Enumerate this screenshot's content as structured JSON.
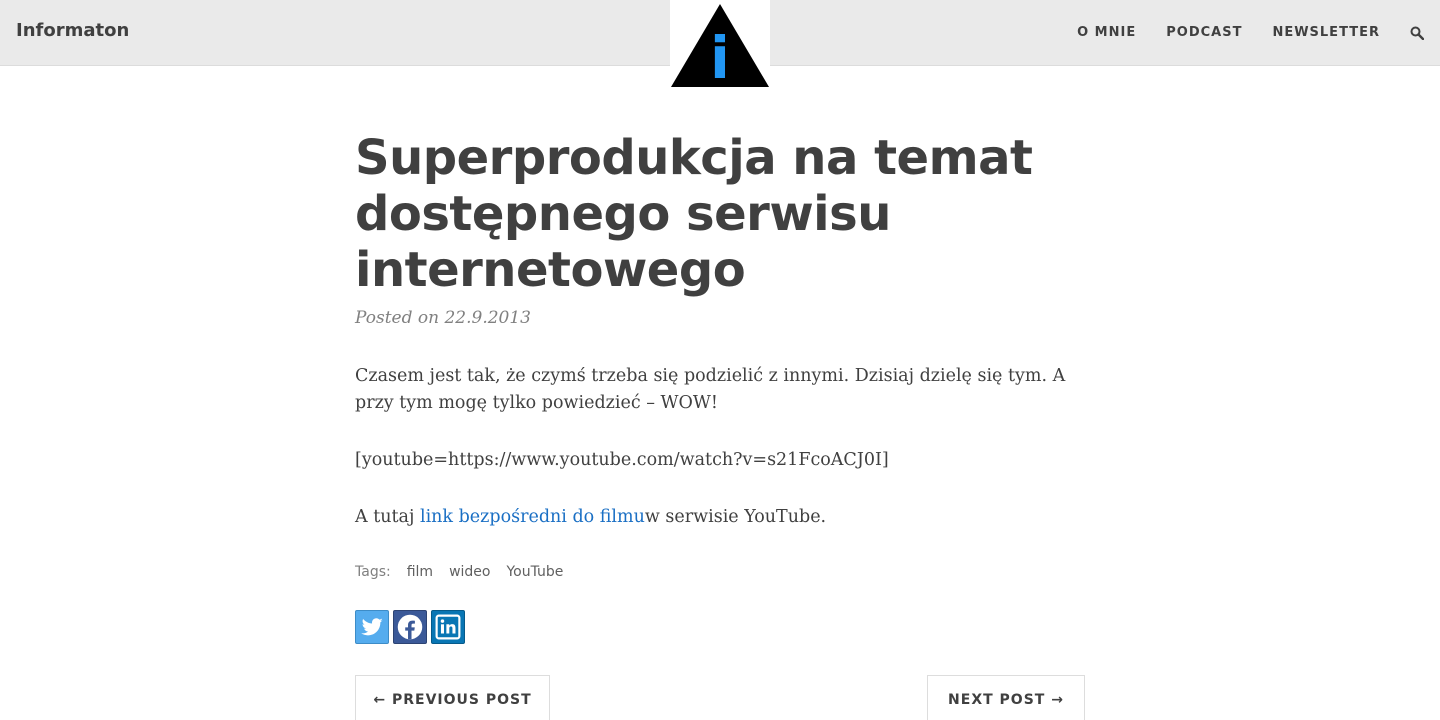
{
  "navbar": {
    "brand": "Informaton",
    "logo_glyph": "i",
    "links": [
      "O MNIE",
      "PODCAST",
      "NEWSLETTER"
    ],
    "search_icon": "search-icon"
  },
  "post": {
    "title": "Superprodukcja na temat dostępnego serwisu internetowego",
    "meta": "Posted on 22.9.2013",
    "paragraph1": "Czasem jest tak, że czymś trzeba się podzielić z innymi. Dzisiaj dzielę się tym. A przy tym mogę tylko powiedzieć – WOW!",
    "paragraph2": "[youtube=https://www.youtube.com/watch?v=s21FcoACJ0I]",
    "paragraph3_before": "A tutaj ",
    "paragraph3_link": "link bezpośredni do filmu",
    "paragraph3_after": "w serwisie YouTube."
  },
  "tags": {
    "label": "Tags:",
    "items": [
      "film",
      "wideo",
      "YouTube"
    ]
  },
  "share": {
    "buttons": [
      "twitter-icon",
      "facebook-icon",
      "linkedin-icon"
    ]
  },
  "pager": {
    "previous": "← PREVIOUS POST",
    "next": "NEXT POST →"
  },
  "colors": {
    "navbar_bg": "#eaeaea",
    "link": "#1a6fc4",
    "logo_blue": "#2196f3",
    "twitter": "#55acee",
    "facebook": "#3b5998",
    "linkedin": "#0976b4"
  }
}
